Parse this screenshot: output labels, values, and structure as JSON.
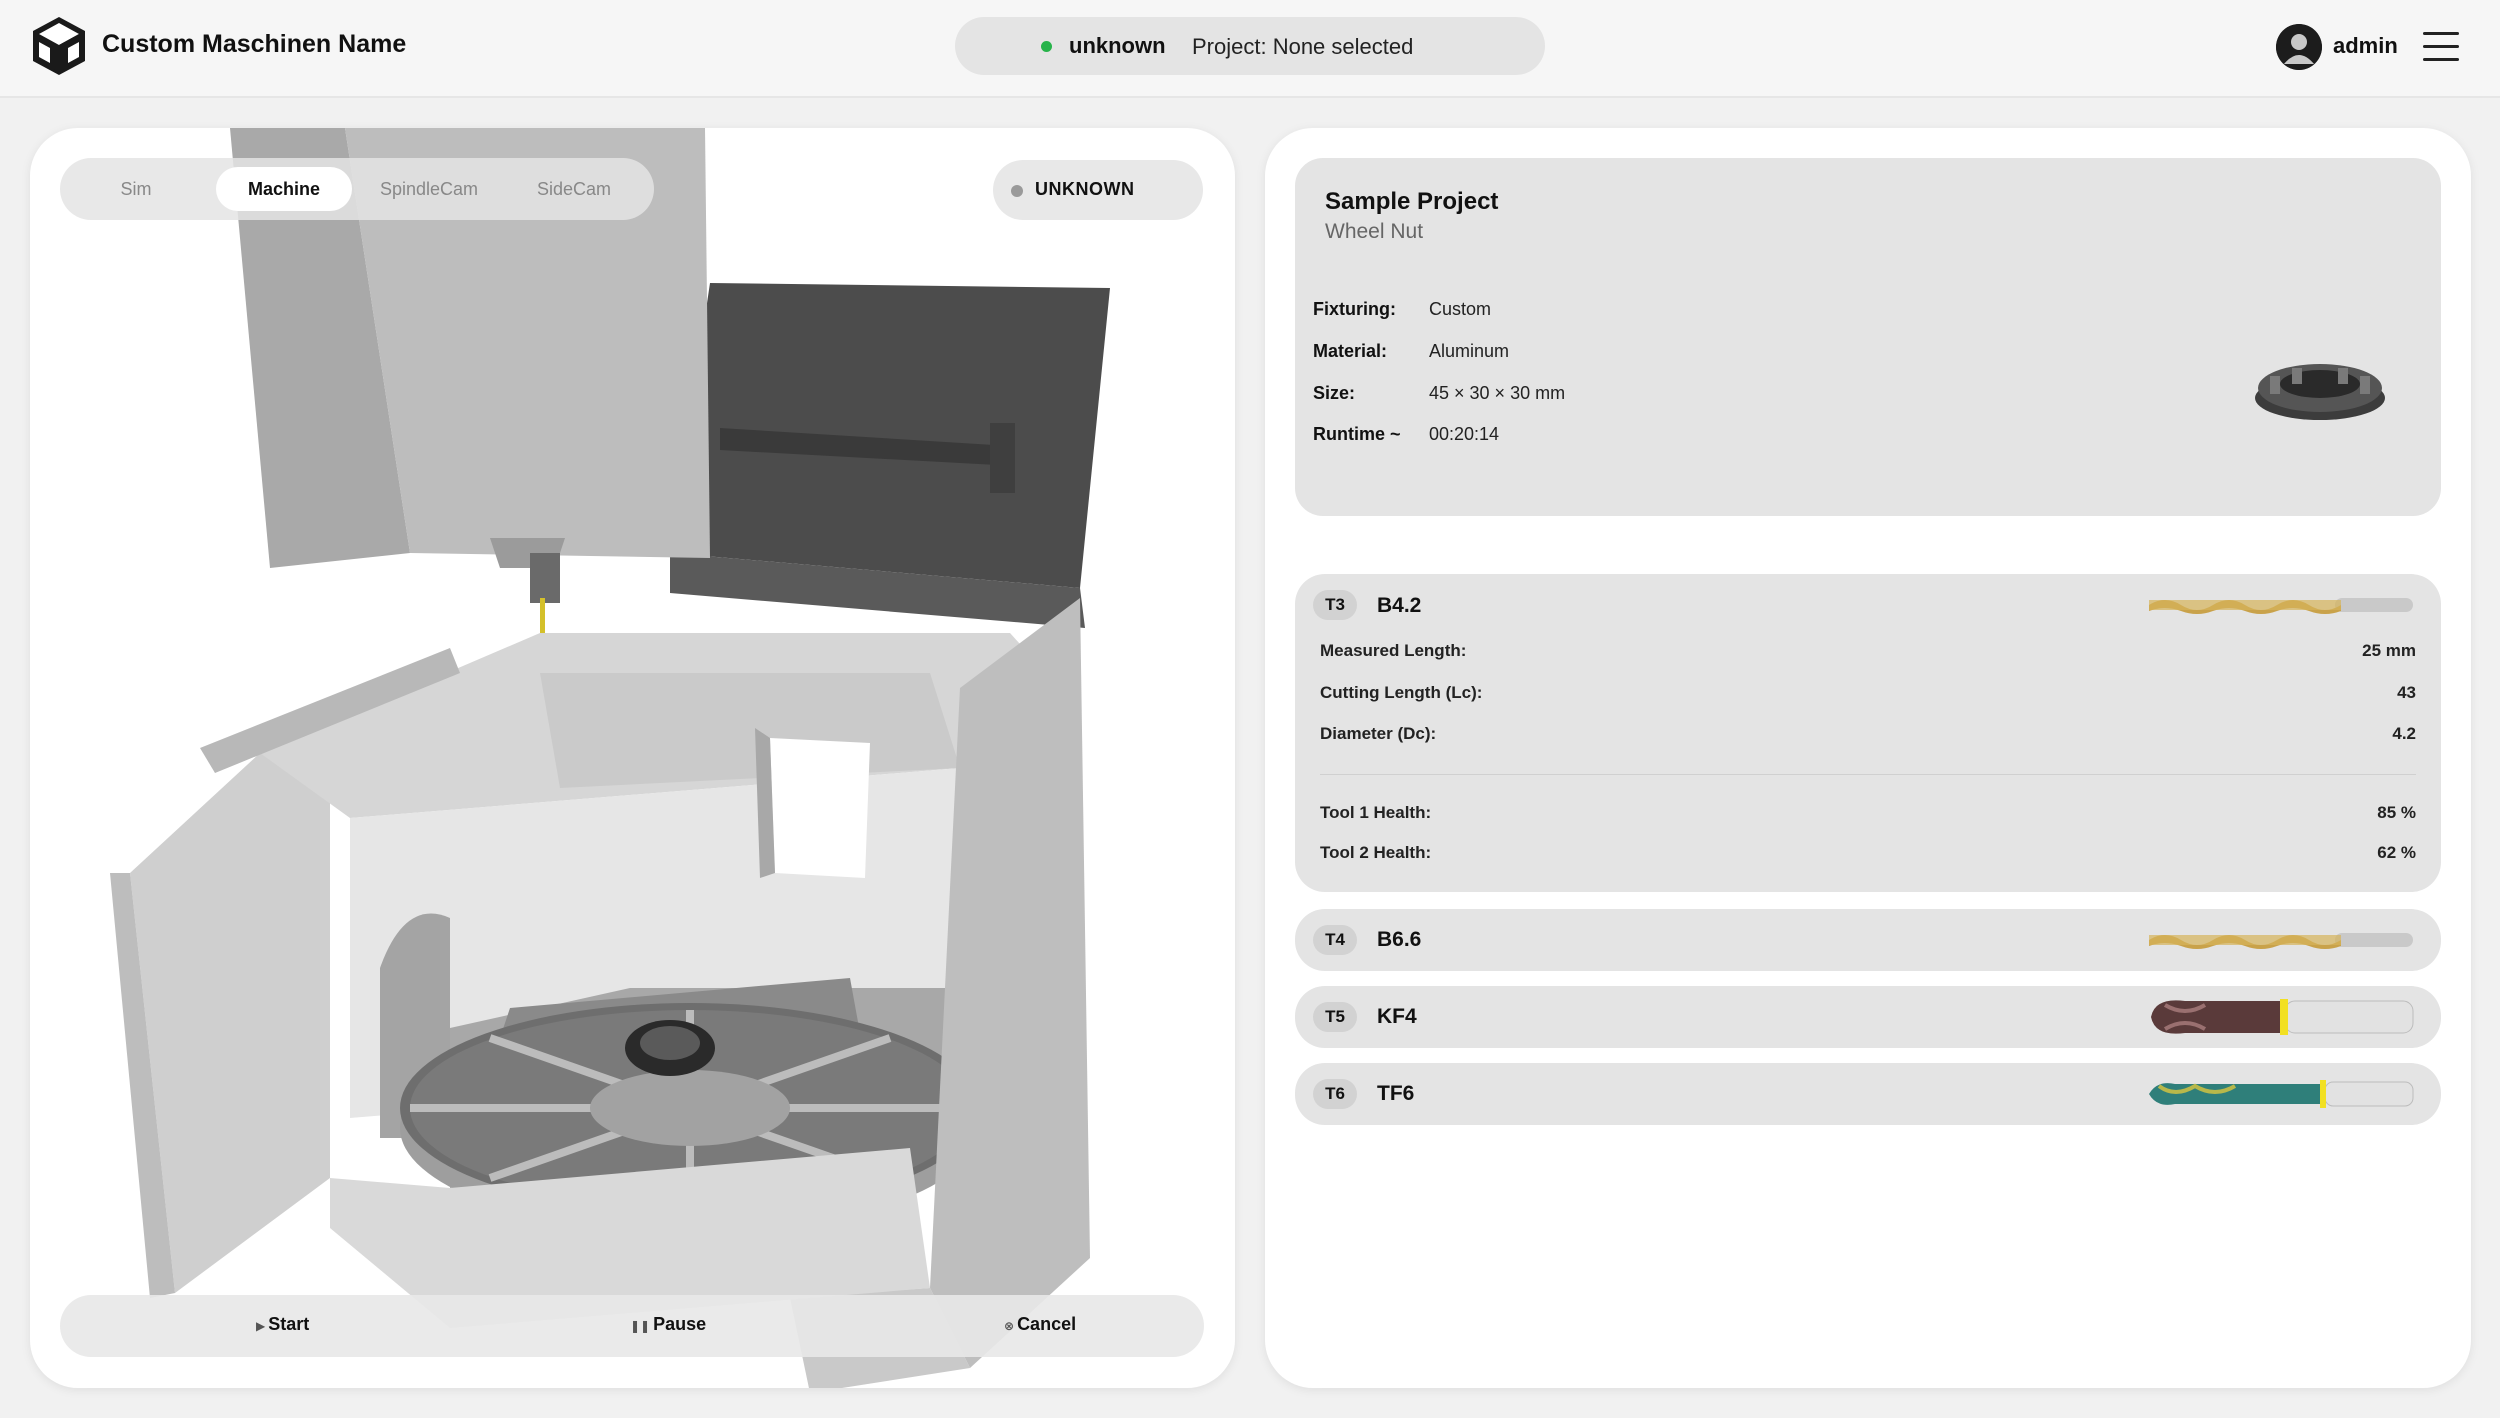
{
  "header": {
    "app_title": "Custom Maschinen Name",
    "status": "unknown",
    "project": "Project: None selected",
    "user": "admin"
  },
  "viewer": {
    "tabs": [
      {
        "label": "Sim",
        "active": false
      },
      {
        "label": "Machine",
        "active": true
      },
      {
        "label": "SpindleCam",
        "active": false
      },
      {
        "label": "SideCam",
        "active": false
      }
    ],
    "machine_state": "UNKNOWN",
    "controls": {
      "start": "Start",
      "pause": "Pause",
      "cancel": "Cancel"
    }
  },
  "project": {
    "title": "Sample Project",
    "subtitle": "Wheel Nut",
    "details": [
      {
        "label": "Fixturing:",
        "value": "Custom"
      },
      {
        "label": "Material:",
        "value": "Aluminum"
      },
      {
        "label": "Size:",
        "value": "45 × 30 × 30 mm"
      },
      {
        "label": "Runtime ~",
        "value": "00:20:14"
      }
    ]
  },
  "tools": [
    {
      "id": "T3",
      "name": "B4.2",
      "expanded": true,
      "rows": [
        {
          "label": "Measured Length:",
          "value": "25 mm"
        },
        {
          "label": "Cutting Length (Lc):",
          "value": "43"
        },
        {
          "label": "Diameter (Dc):",
          "value": "4.2"
        }
      ],
      "health": [
        {
          "label": "Tool 1 Health:",
          "value": "85 %"
        },
        {
          "label": "Tool 2 Health:",
          "value": "62 %"
        }
      ]
    },
    {
      "id": "T4",
      "name": "B6.6",
      "expanded": false
    },
    {
      "id": "T5",
      "name": "KF4",
      "expanded": false
    },
    {
      "id": "T6",
      "name": "TF6",
      "expanded": false
    }
  ],
  "icons": {
    "logo": "cube-logo-icon",
    "avatar": "user-avatar-icon",
    "menu": "hamburger-menu-icon",
    "start": "play-icon",
    "pause": "pause-icon",
    "cancel": "cancel-icon"
  },
  "colors": {
    "status_ok": "#27b34a",
    "status_unknown": "#9a9a9a",
    "panel_bg": "#ffffff",
    "card_bg": "#e4e4e4"
  }
}
